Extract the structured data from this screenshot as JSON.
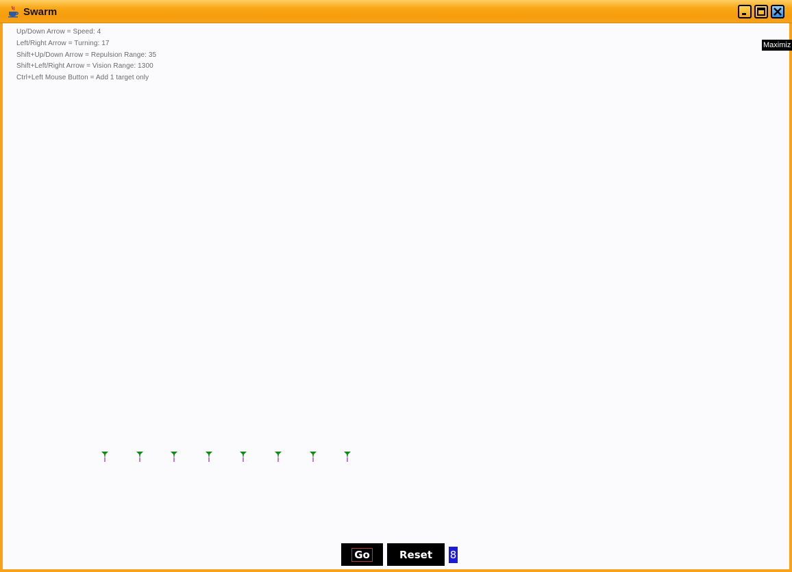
{
  "window": {
    "title": "Swarm",
    "tooltip": "Maximiz",
    "buttons": {
      "minimize": "minimize-icon",
      "maximize": "maximize-icon",
      "close": "close-icon"
    }
  },
  "help_lines": [
    "Up/Down Arrow = Speed: 4",
    "Left/Right Arrow = Turning: 17",
    "Shift+Up/Down Arrow = Repulsion Range: 35",
    "Shift+Left/Right Arrow = Vision Range: 1300",
    "Ctrl+Left Mouse Button = Add 1 target only"
  ],
  "agents": {
    "count": 8,
    "body_color": "#0f8a12",
    "tail_color": "#b14cc7"
  },
  "controls": {
    "go_label": "Go",
    "reset_label": "Reset",
    "count_value": "8"
  },
  "colors": {
    "titlebar": "#f9a818",
    "frame": "#f7a21a",
    "canvas": "#fbfafc"
  }
}
